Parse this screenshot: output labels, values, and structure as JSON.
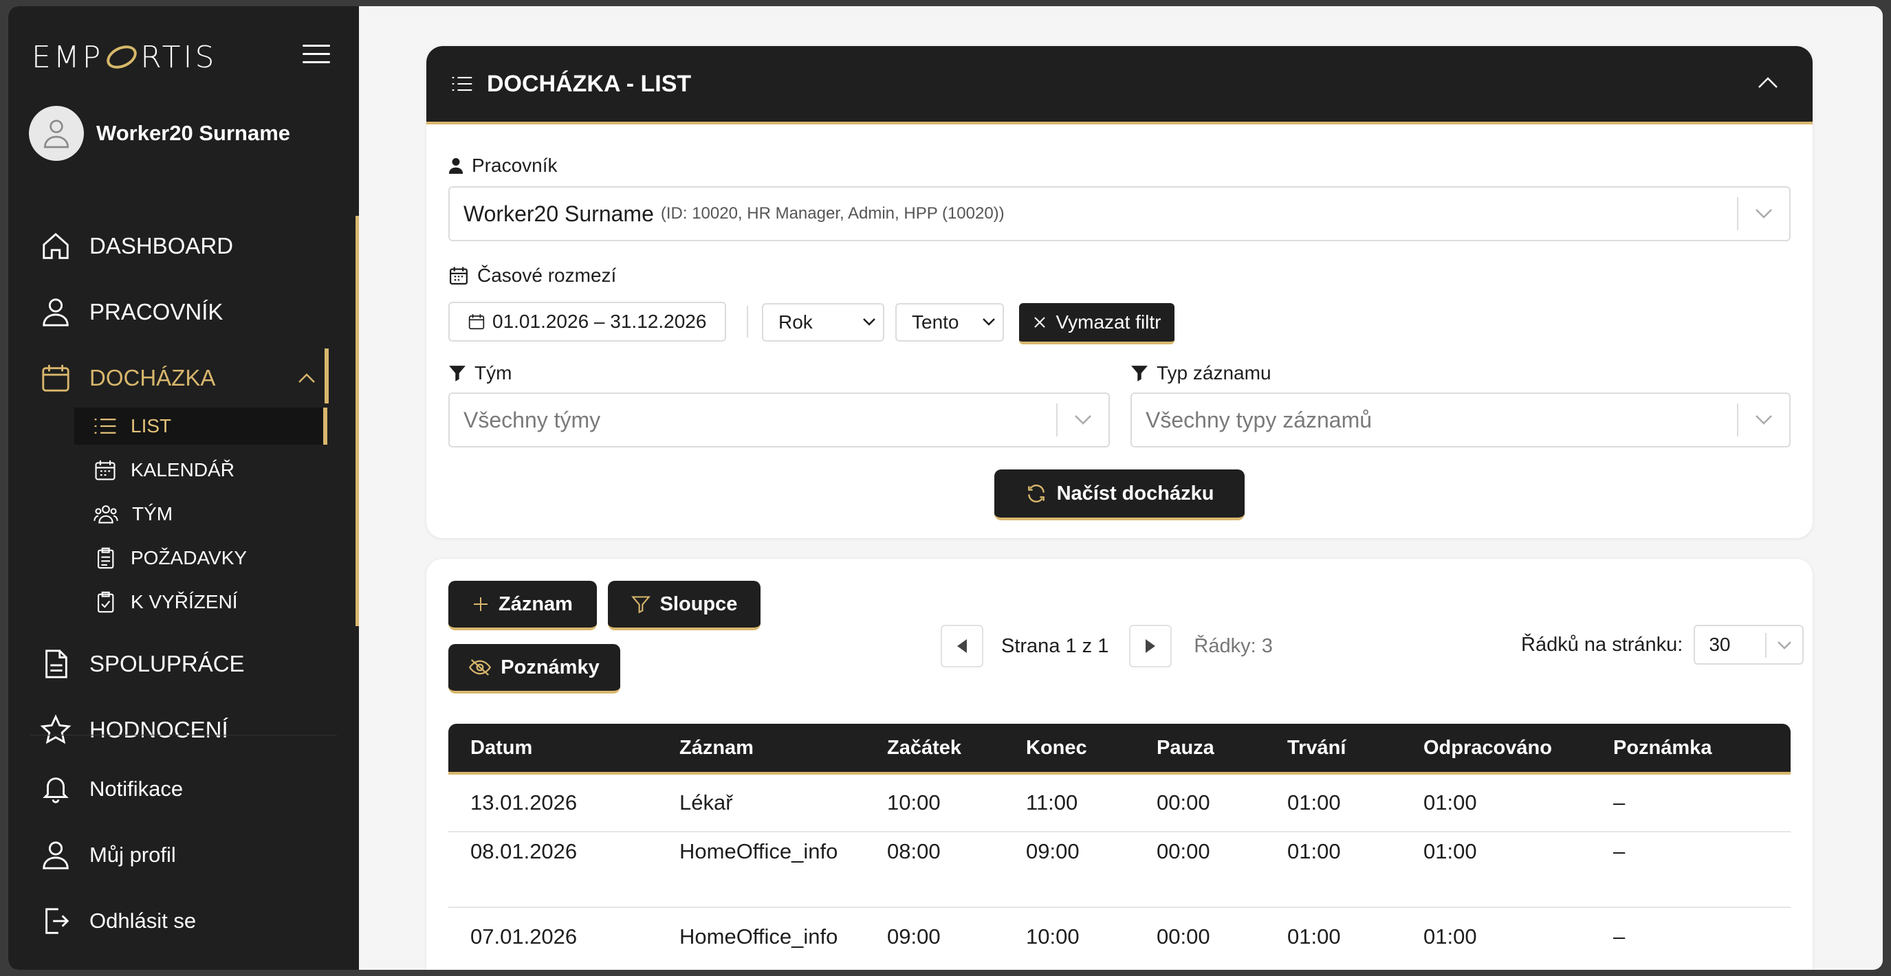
{
  "app": {
    "logo": "EMPORTIS",
    "logo_left": "EMP",
    "logo_right": "RTIS"
  },
  "user": {
    "name": "Worker20 Surname"
  },
  "nav": {
    "dashboard": "DASHBOARD",
    "pracovnik": "PRACOVNÍK",
    "dochazka": "DOCHÁZKA",
    "sub": {
      "list": "LIST",
      "kalendar": "KALENDÁŘ",
      "tym": "TÝM",
      "pozadavky": "POŽADAVKY",
      "k_vyrizeni": "K VYŘÍZENÍ"
    },
    "spoluprace": "SPOLUPRÁCE",
    "hodnoceni": "HODNOCENÍ",
    "notifikace": "Notifikace",
    "muj_profil": "Můj profil",
    "odhlasit": "Odhlásit se"
  },
  "colors": {
    "accent": "#d8b76d",
    "dark": "#1f1f1f"
  },
  "filter": {
    "title": "DOCHÁZKA - LIST",
    "worker_label": "Pracovník",
    "worker_value": "Worker20 Surname",
    "worker_meta": "(ID: 10020, HR Manager, Admin, HPP (10020))",
    "range_label": "Časové rozmezí",
    "date_range": "01.01.2026 – 31.12.2026",
    "period_select": "Rok",
    "which_select": "Tento",
    "clear_filter": "Vymazat filtr",
    "team_label": "Tým",
    "team_placeholder": "Všechny týmy",
    "type_label": "Typ záznamu",
    "type_placeholder": "Všechny typy záznamů",
    "load_button": "Načíst docházku"
  },
  "toolbar": {
    "add_record": "Záznam",
    "columns": "Sloupce",
    "notes": "Poznámky",
    "page_text": "Strana 1 z 1",
    "rows_text": "Řádky: 3",
    "rows_per_page_label": "Řádků na stránku:",
    "rows_per_page": "30"
  },
  "table": {
    "headers": [
      "Datum",
      "Záznam",
      "Začátek",
      "Konec",
      "Pauza",
      "Trvání",
      "Odpracováno",
      "Poznámka"
    ],
    "rows": [
      [
        "13.01.2026",
        "Lékař",
        "10:00",
        "11:00",
        "00:00",
        "01:00",
        "01:00",
        "–"
      ],
      [
        "08.01.2026",
        "HomeOffice_info",
        "08:00",
        "09:00",
        "00:00",
        "01:00",
        "01:00",
        "–"
      ],
      [
        "07.01.2026",
        "HomeOffice_info",
        "09:00",
        "10:00",
        "00:00",
        "01:00",
        "01:00",
        "–"
      ]
    ]
  }
}
